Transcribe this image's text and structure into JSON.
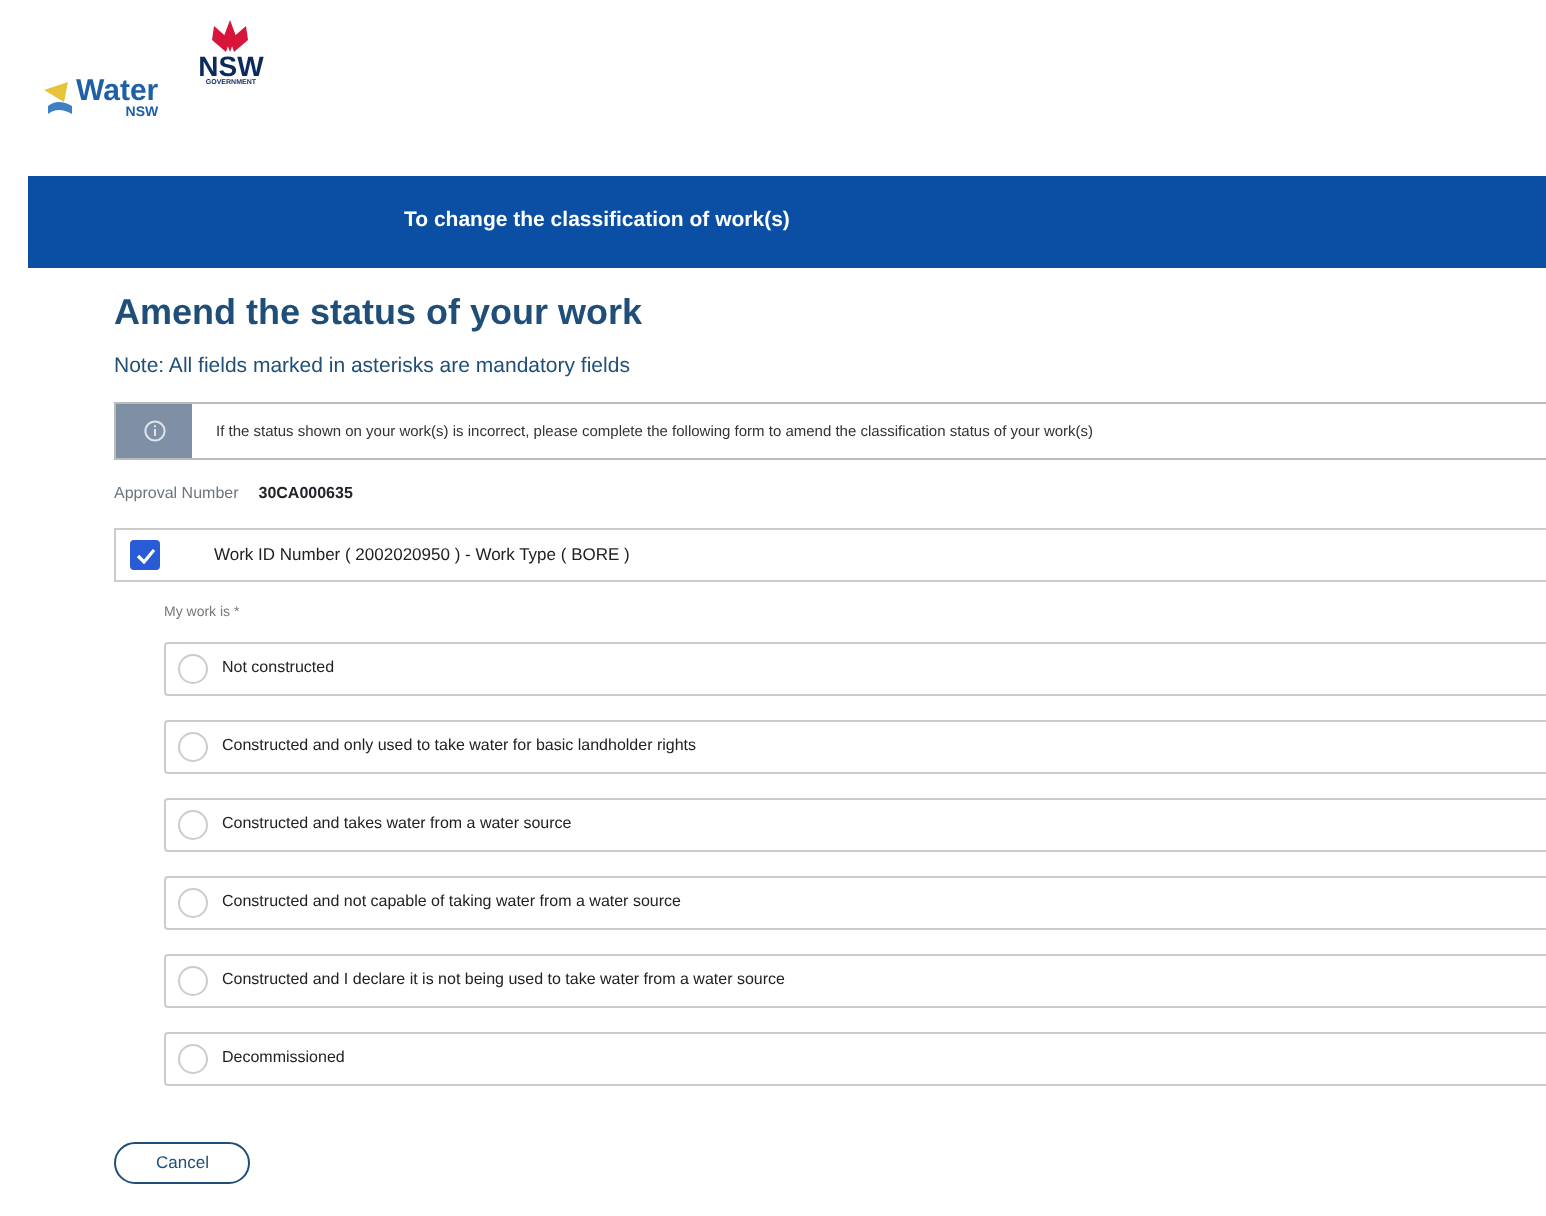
{
  "logos": [
    {
      "kind": "water",
      "word": "Water",
      "sub": "NSW"
    },
    {
      "kind": "nsw",
      "word": "NSW",
      "sub": "GOVERNMENT"
    }
  ],
  "banner": {
    "title": "To change the classification of work(s)"
  },
  "heading": "Amend the status of your work",
  "note": "Note: All fields marked in asterisks are mandatory fields",
  "info": "If the status shown on your work(s) is incorrect, please complete the following form to amend the classification status of your work(s)",
  "approval": {
    "label": "Approval Number",
    "value": "30CA000635"
  },
  "work": {
    "label": "Work ID Number ( 2002020950 ) - Work Type ( BORE )",
    "checked": true
  },
  "question": "My work is *",
  "options": [
    {
      "label": "Not constructed",
      "selected": false
    },
    {
      "label": "Constructed and only used to take water for basic landholder rights",
      "selected": false
    },
    {
      "label": "Constructed and takes water from a water source",
      "selected": false
    },
    {
      "label": "Constructed and not capable of taking water from a water source",
      "selected": false
    },
    {
      "label": "Constructed and I declare it is not being used to take water from a water source",
      "selected": false
    },
    {
      "label": "Decommissioned",
      "selected": false
    }
  ],
  "buttons": [
    "Cancel"
  ]
}
